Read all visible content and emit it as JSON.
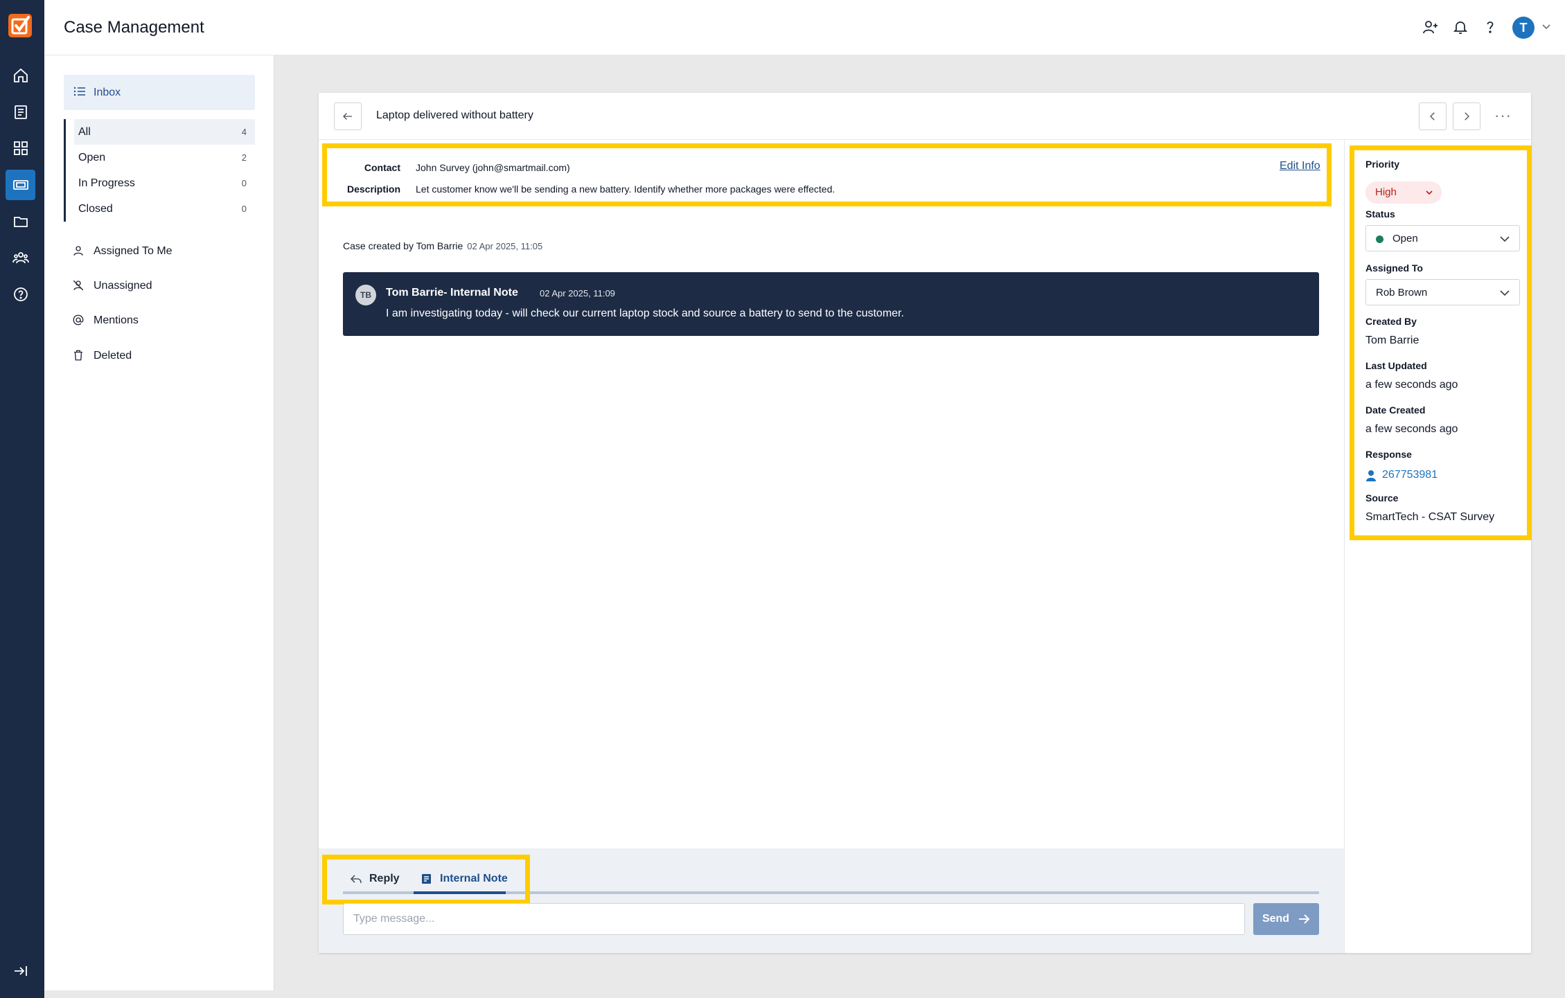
{
  "app": {
    "title": "Case Management",
    "user_initial": "T"
  },
  "sidebar": {
    "inbox_label": "Inbox",
    "filters": [
      {
        "label": "All",
        "count": "4"
      },
      {
        "label": "Open",
        "count": "2"
      },
      {
        "label": "In Progress",
        "count": "0"
      },
      {
        "label": "Closed",
        "count": "0"
      }
    ],
    "links": [
      {
        "label": "Assigned To Me",
        "icon": "user-icon"
      },
      {
        "label": "Unassigned",
        "icon": "user-off-icon"
      },
      {
        "label": "Mentions",
        "icon": "at-icon"
      },
      {
        "label": "Deleted",
        "icon": "trash-icon"
      }
    ]
  },
  "case": {
    "title": "Laptop delivered without battery",
    "contact_label": "Contact",
    "contact_value": "John Survey (john@smartmail.com)",
    "description_label": "Description",
    "description_value": "Let customer know we'll be sending a new battery. Identify whether more packages were effected.",
    "edit_info": "Edit Info",
    "created_text": "Case created by Tom Barrie",
    "created_date": "02 Apr 2025, 11:05",
    "note": {
      "initials": "TB",
      "author": "Tom Barrie- Internal Note",
      "date": "02 Apr 2025, 11:09",
      "message": "I am investigating today - will check our current laptop stock and source a battery to send to the customer."
    }
  },
  "composer": {
    "tab_reply": "Reply",
    "tab_internal": "Internal Note",
    "placeholder": "Type message...",
    "send_label": "Send"
  },
  "details": {
    "priority_label": "Priority",
    "priority_value": "High",
    "status_label": "Status",
    "status_value": "Open",
    "assigned_label": "Assigned To",
    "assigned_value": "Rob Brown",
    "created_by_label": "Created By",
    "created_by_value": "Tom Barrie",
    "last_updated_label": "Last Updated",
    "last_updated_value": "a few seconds ago",
    "date_created_label": "Date Created",
    "date_created_value": "a few seconds ago",
    "response_label": "Response",
    "response_value": "267753981",
    "source_label": "Source",
    "source_value": "SmartTech - CSAT Survey"
  },
  "colors": {
    "rail": "#1b2a45",
    "accent": "#1e73be",
    "highlight": "#ffcc00",
    "note_bg": "#1d2b45",
    "priority_high": "#b42318",
    "status_open": "#1a7f5a"
  }
}
